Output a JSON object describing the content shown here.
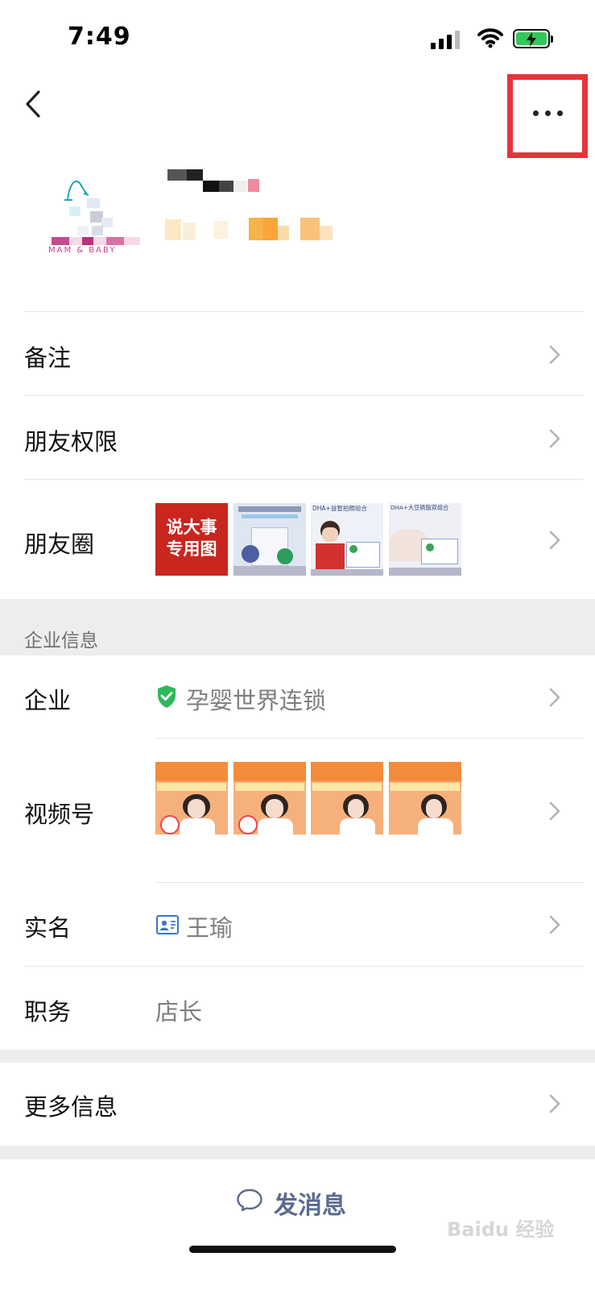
{
  "status_bar": {
    "time": "7:49"
  },
  "profile": {
    "avatar_caption": "MAM & BABY"
  },
  "rows": {
    "remark": {
      "label": "备注"
    },
    "permission": {
      "label": "朋友权限"
    },
    "moments": {
      "label": "朋友圈",
      "thumb_texts": [
        "说大事\n专用图",
        "DHA+益智拍照组合",
        "DHA+大豆磷脂双组合"
      ]
    }
  },
  "section": {
    "title": "企业信息"
  },
  "enterprise": {
    "company_label": "企业",
    "company_value": "孕婴世界连锁",
    "channels_label": "视频号",
    "realname_label": "实名",
    "realname_value": "王瑜",
    "position_label": "职务",
    "position_value": "店长"
  },
  "more_info": {
    "label": "更多信息"
  },
  "actions": {
    "send_message": "发消息"
  },
  "watermark": "Baidu 经验",
  "colors": {
    "accent_red": "#e8333a",
    "verified_green": "#2fb85a",
    "send_blue": "#5b6b90"
  },
  "icons": [
    "back-chevron-icon",
    "more-dots-icon",
    "chevron-right-icon",
    "verified-shield-icon",
    "id-card-icon",
    "chat-bubble-icon"
  ]
}
